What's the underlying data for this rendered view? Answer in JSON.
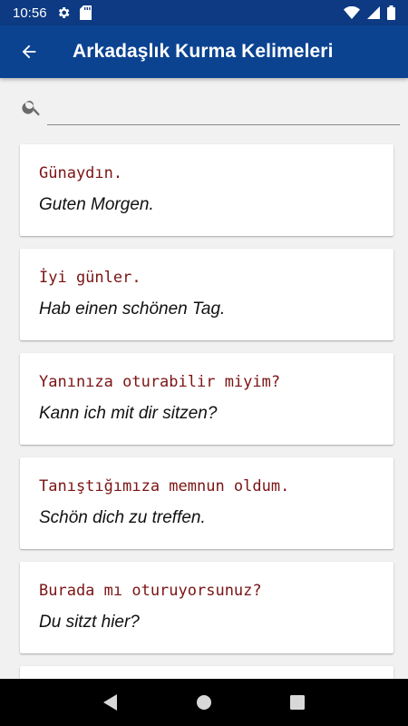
{
  "status_bar": {
    "time": "10:56",
    "icons": [
      "settings-icon",
      "sd-card-icon",
      "wifi-icon",
      "signal-icon",
      "battery-icon"
    ]
  },
  "app_bar": {
    "title": "Arkadaşlık Kurma Kelimeleri",
    "back_icon": "arrow-back-icon",
    "color": "#0b4391"
  },
  "search": {
    "value": "",
    "placeholder": ""
  },
  "phrases": [
    {
      "tr": "Günaydın.",
      "de": "Guten Morgen."
    },
    {
      "tr": "İyi günler.",
      "de": "Hab einen schönen Tag."
    },
    {
      "tr": "Yanınıza oturabilir miyim?",
      "de": "Kann ich mit dir sitzen?"
    },
    {
      "tr": "Tanıştığımıza memnun oldum.",
      "de": "Schön dich zu treffen."
    },
    {
      "tr": "Burada mı oturuyorsunuz?",
      "de": "Du sitzt hier?"
    }
  ],
  "nav_bar": {
    "icons": [
      "back-triangle-icon",
      "home-circle-icon",
      "recents-square-icon"
    ]
  },
  "colors": {
    "phrase_source": "#7b1414",
    "status_bar": "#0d3a82"
  }
}
